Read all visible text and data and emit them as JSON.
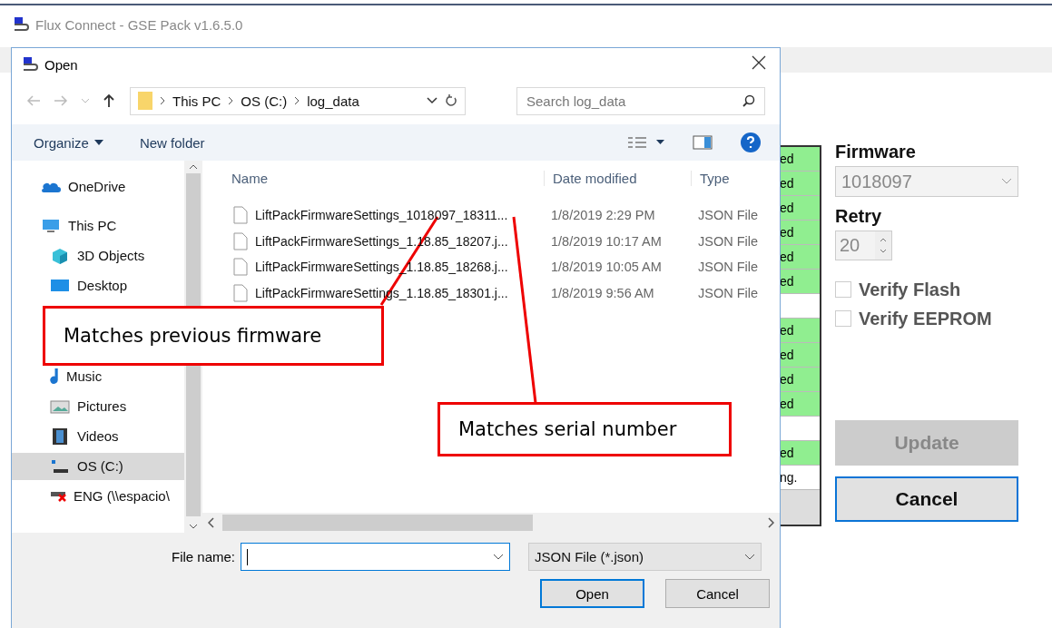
{
  "app": {
    "title": "Flux Connect - GSE Pack v1.6.5.0"
  },
  "status_column": [
    {
      "text": "ed",
      "highlighted": true
    },
    {
      "text": "ed",
      "highlighted": true
    },
    {
      "text": "ed",
      "highlighted": true
    },
    {
      "text": "ed",
      "highlighted": true
    },
    {
      "text": "ed",
      "highlighted": true
    },
    {
      "text": "ed",
      "highlighted": true
    },
    {
      "highlighted": false
    },
    {
      "text": "ed",
      "highlighted": true
    },
    {
      "text": "ed",
      "highlighted": true
    },
    {
      "text": "ed",
      "highlighted": true
    },
    {
      "text": "ed",
      "highlighted": true
    },
    {
      "highlighted": false
    },
    {
      "text": "ed",
      "highlighted": true
    },
    {
      "text": "ng.",
      "highlighted": false
    }
  ],
  "settings": {
    "firmware_label": "Firmware",
    "firmware_value": "1018097",
    "retry_label": "Retry",
    "retry_value": "20",
    "checkboxes": [
      {
        "label": "Verify Flash",
        "checked": false
      },
      {
        "label": "Verify EEPROM",
        "checked": false
      }
    ],
    "buttons": [
      {
        "label": "Update",
        "disabled": true
      },
      {
        "label": "Cancel",
        "disabled": false
      }
    ]
  },
  "dialog": {
    "title": "Open",
    "breadcrumb": [
      "This PC",
      "OS (C:)",
      "log_data"
    ],
    "search_placeholder": "Search log_data",
    "toolbar": [
      {
        "label": "Organize",
        "dropdown": true
      },
      {
        "label": "New folder",
        "dropdown": false
      }
    ],
    "sidebar": [
      {
        "label": "OneDrive",
        "kind": "cloud",
        "selected": false
      },
      {
        "label": "This PC",
        "kind": "pc",
        "selected": false,
        "children": [
          {
            "label": "3D Objects",
            "kind": "cube",
            "selected": false
          },
          {
            "label": "Desktop",
            "kind": "desktop",
            "selected": false
          },
          {
            "label": "Music",
            "kind": "music",
            "selected": false
          },
          {
            "label": "Pictures",
            "kind": "pictures",
            "selected": false
          },
          {
            "label": "Videos",
            "kind": "videos",
            "selected": false
          },
          {
            "label": "OS (C:)",
            "kind": "drive",
            "selected": true
          },
          {
            "label": "ENG (\\\\espacio\\",
            "kind": "netdrive",
            "selected": false
          }
        ]
      }
    ],
    "columns": [
      "Name",
      "Date modified",
      "Type"
    ],
    "files": [
      {
        "name": "LiftPackFirmwareSettings_1018097_18311...",
        "date": "1/8/2019 2:29 PM",
        "type": "JSON File"
      },
      {
        "name": "LiftPackFirmwareSettings_1.18.85_18207.j...",
        "date": "1/8/2019 10:17 AM",
        "type": "JSON File"
      },
      {
        "name": "LiftPackFirmwareSettings_1.18.85_18268.j...",
        "date": "1/8/2019 10:05 AM",
        "type": "JSON File"
      },
      {
        "name": "LiftPackFirmwareSettings_1.18.85_18301.j...",
        "date": "1/8/2019 9:56 AM",
        "type": "JSON File"
      }
    ],
    "file_name_label": "File name:",
    "filter": "JSON File (*.json)",
    "actions": [
      {
        "label": "Open",
        "default": true
      },
      {
        "label": "Cancel",
        "default": false
      }
    ]
  },
  "annotations": [
    {
      "text": "Matches previous firmware"
    },
    {
      "text": "Matches serial number"
    }
  ]
}
